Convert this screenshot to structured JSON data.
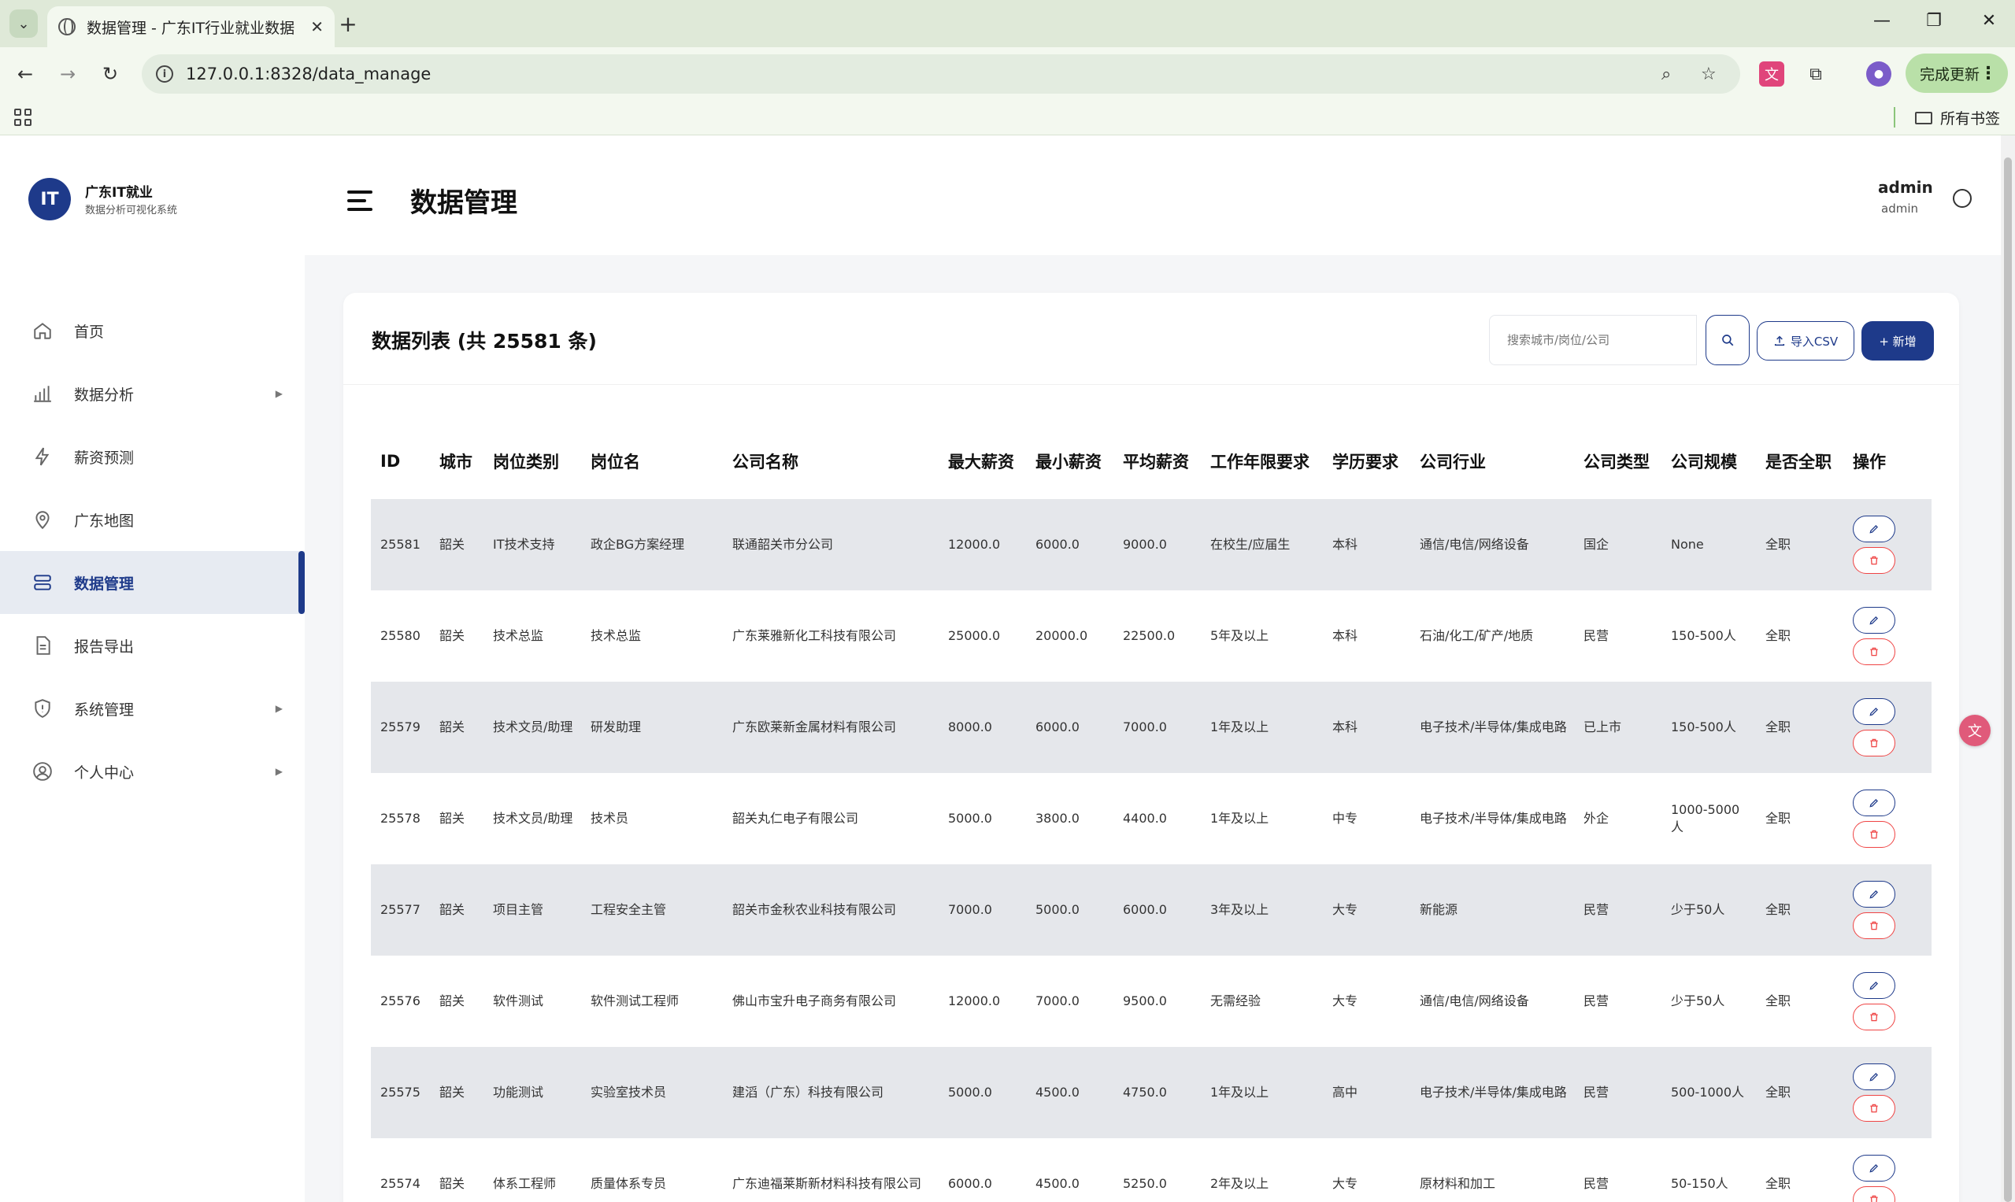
{
  "browser": {
    "tab_title": "数据管理 - 广东IT行业就业数据",
    "url": "127.0.0.1:8328/data_manage",
    "update_label": "完成更新",
    "bookmarks_label": "所有书签"
  },
  "sidebar": {
    "logo_text": "IT",
    "title": "广东IT就业",
    "subtitle": "数据分析可视化系统",
    "items": [
      {
        "label": "首页",
        "icon": "home-icon"
      },
      {
        "label": "数据分析",
        "icon": "bar-chart-icon"
      },
      {
        "label": "薪资预测",
        "icon": "lightning-icon"
      },
      {
        "label": "广东地图",
        "icon": "map-pin-icon"
      },
      {
        "label": "数据管理",
        "icon": "database-icon"
      },
      {
        "label": "报告导出",
        "icon": "document-icon"
      },
      {
        "label": "系统管理",
        "icon": "shield-icon"
      },
      {
        "label": "个人中心",
        "icon": "user-circle-icon"
      }
    ]
  },
  "header": {
    "title": "数据管理",
    "user_name": "admin",
    "user_role": "admin"
  },
  "card": {
    "title": "数据列表 (共 25581 条)",
    "search_placeholder": "搜索城市/岗位/公司",
    "import_label": "导入CSV",
    "add_label": "+ 新增"
  },
  "table": {
    "columns": [
      "ID",
      "城市",
      "岗位类别",
      "岗位名",
      "公司名称",
      "最大薪资",
      "最小薪资",
      "平均薪资",
      "工作年限要求",
      "学历要求",
      "公司行业",
      "公司类型",
      "公司规模",
      "是否全职",
      "操作"
    ],
    "rows": [
      [
        "25581",
        "韶关",
        "IT技术支持",
        "政企BG方案经理",
        "联通韶关市分公司",
        "12000.0",
        "6000.0",
        "9000.0",
        "在校生/应届生",
        "本科",
        "通信/电信/网络设备",
        "国企",
        "None",
        "全职"
      ],
      [
        "25580",
        "韶关",
        "技术总监",
        "技术总监",
        "广东莱雅新化工科技有限公司",
        "25000.0",
        "20000.0",
        "22500.0",
        "5年及以上",
        "本科",
        "石油/化工/矿产/地质",
        "民营",
        "150-500人",
        "全职"
      ],
      [
        "25579",
        "韶关",
        "技术文员/助理",
        "研发助理",
        "广东欧莱新金属材料有限公司",
        "8000.0",
        "6000.0",
        "7000.0",
        "1年及以上",
        "本科",
        "电子技术/半导体/集成电路",
        "已上市",
        "150-500人",
        "全职"
      ],
      [
        "25578",
        "韶关",
        "技术文员/助理",
        "技术员",
        "韶关丸仁电子有限公司",
        "5000.0",
        "3800.0",
        "4400.0",
        "1年及以上",
        "中专",
        "电子技术/半导体/集成电路",
        "外企",
        "1000-5000人",
        "全职"
      ],
      [
        "25577",
        "韶关",
        "项目主管",
        "工程安全主管",
        "韶关市金秋农业科技有限公司",
        "7000.0",
        "5000.0",
        "6000.0",
        "3年及以上",
        "大专",
        "新能源",
        "民营",
        "少于50人",
        "全职"
      ],
      [
        "25576",
        "韶关",
        "软件测试",
        "软件测试工程师",
        "佛山市宝升电子商务有限公司",
        "12000.0",
        "7000.0",
        "9500.0",
        "无需经验",
        "大专",
        "通信/电信/网络设备",
        "民营",
        "少于50人",
        "全职"
      ],
      [
        "25575",
        "韶关",
        "功能测试",
        "实验室技术员",
        "建滔（广东）科技有限公司",
        "5000.0",
        "4500.0",
        "4750.0",
        "1年及以上",
        "高中",
        "电子技术/半导体/集成电路",
        "民营",
        "500-1000人",
        "全职"
      ],
      [
        "25574",
        "韶关",
        "体系工程师",
        "质量体系专员",
        "广东迪福莱斯新材料科技有限公司",
        "6000.0",
        "4500.0",
        "5250.0",
        "2年及以上",
        "大专",
        "原材料和加工",
        "民营",
        "50-150人",
        "全职"
      ]
    ]
  },
  "colors": {
    "primary": "#1e3a8a",
    "danger": "#ef4444",
    "row_alt": "#e5e7eb",
    "chrome": "#dfe9d8"
  }
}
